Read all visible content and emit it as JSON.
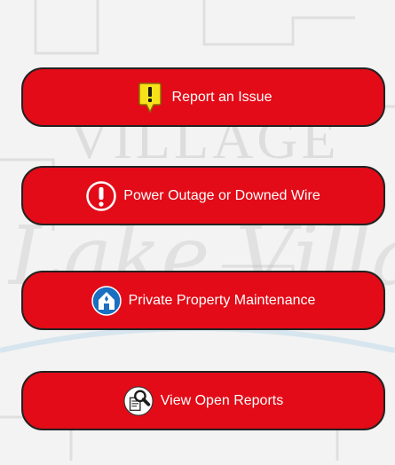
{
  "background": {
    "watermark_top": "VILLAGE OF",
    "watermark_script": "Lake Villa"
  },
  "buttons": [
    {
      "label": "Report an Issue",
      "icon": "alert-pin-icon"
    },
    {
      "label": "Power Outage or Downed Wire",
      "icon": "exclamation-icon"
    },
    {
      "label": "Private Property Maintenance",
      "icon": "house-icon"
    },
    {
      "label": "View Open Reports",
      "icon": "magnifier-document-icon"
    }
  ],
  "colors": {
    "button_red": "#e20b17",
    "button_border": "#222222",
    "pin_yellow": "#f7e21a",
    "house_blue": "#1a6fc0"
  }
}
